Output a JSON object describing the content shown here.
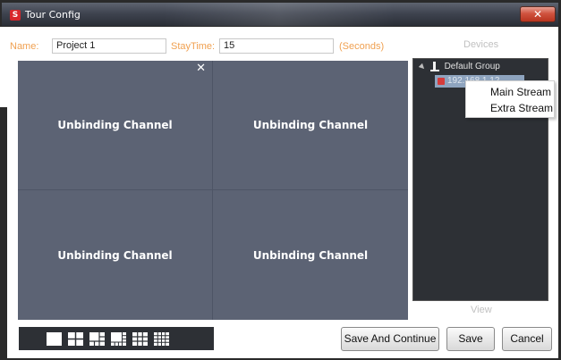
{
  "window": {
    "title": "Tour Config",
    "close_glyph": "✕",
    "app_icon": "S"
  },
  "form": {
    "name_label": "Name:",
    "name_value": "Project 1",
    "staytime_label": "StayTime:",
    "staytime_value": "15",
    "seconds_label": "(Seconds)"
  },
  "grid": {
    "close_glyph": "✕",
    "cells": [
      "Unbinding Channel",
      "Unbinding Channel",
      "Unbinding Channel",
      "Unbinding Channel"
    ]
  },
  "devices": {
    "header": "Devices",
    "root_label": "Default Group",
    "child_label": "192.168.1.12",
    "view_label": "View"
  },
  "context_menu": {
    "items": [
      "Main Stream",
      "Extra Stream"
    ]
  },
  "buttons": {
    "save_continue": "Save And Continue",
    "save": "Save",
    "cancel": "Cancel"
  },
  "layouts": [
    "layout-1x1",
    "layout-2x2",
    "layout-1plus5",
    "layout-1plus7",
    "layout-3x3",
    "layout-4x4"
  ],
  "colors": {
    "label_orange": "#f0a050",
    "grid_bg": "#5c6374",
    "panel_dark": "#2d3035"
  }
}
